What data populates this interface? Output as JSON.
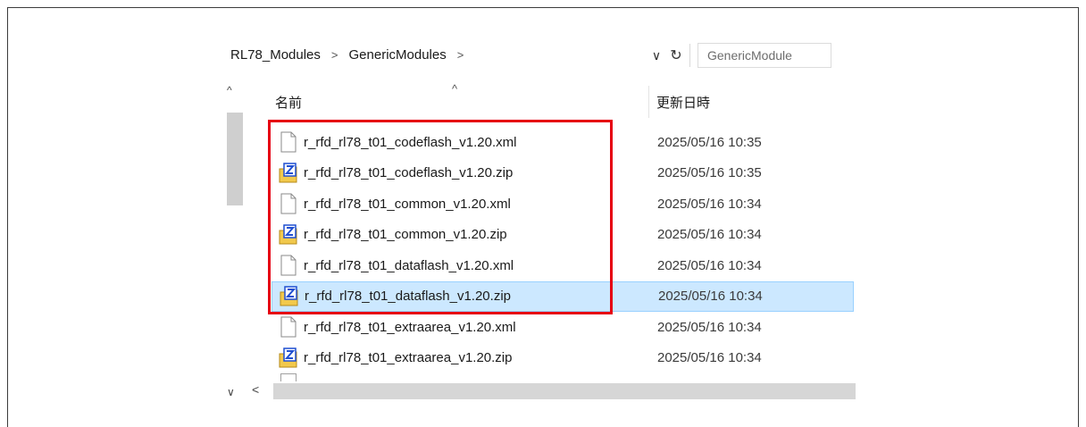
{
  "breadcrumb": {
    "items": [
      "RL78_Modules",
      "GenericModules"
    ],
    "separator": ">"
  },
  "search": {
    "placeholder": "GenericModule"
  },
  "columns": {
    "name": "名前",
    "date": "更新日時"
  },
  "files": [
    {
      "name": "r_rfd_rl78_t01_codeflash_v1.20.xml",
      "date": "2025/05/16 10:35",
      "type": "xml",
      "selected": false
    },
    {
      "name": "r_rfd_rl78_t01_codeflash_v1.20.zip",
      "date": "2025/05/16 10:35",
      "type": "zip",
      "selected": false
    },
    {
      "name": "r_rfd_rl78_t01_common_v1.20.xml",
      "date": "2025/05/16 10:34",
      "type": "xml",
      "selected": false
    },
    {
      "name": "r_rfd_rl78_t01_common_v1.20.zip",
      "date": "2025/05/16 10:34",
      "type": "zip",
      "selected": false
    },
    {
      "name": "r_rfd_rl78_t01_dataflash_v1.20.xml",
      "date": "2025/05/16 10:34",
      "type": "xml",
      "selected": false
    },
    {
      "name": "r_rfd_rl78_t01_dataflash_v1.20.zip",
      "date": "2025/05/16 10:34",
      "type": "zip",
      "selected": true
    },
    {
      "name": "r_rfd_rl78_t01_extraarea_v1.20.xml",
      "date": "2025/05/16 10:34",
      "type": "xml",
      "selected": false
    },
    {
      "name": "r_rfd_rl78_t01_extraarea_v1.20.zip",
      "date": "2025/05/16 10:34",
      "type": "zip",
      "selected": false
    }
  ],
  "colors": {
    "selection": "#cce8ff",
    "highlight": "#e60012",
    "zip_folder": "#f2c94c",
    "zip_badge": "#1f4fd1"
  }
}
